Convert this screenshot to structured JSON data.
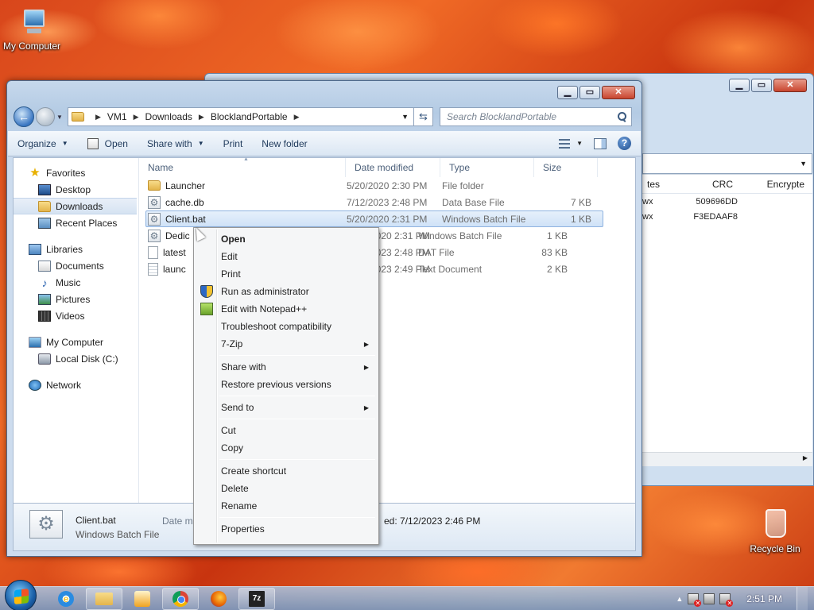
{
  "desktop": {
    "my_computer_label": "My Computer",
    "recycle_bin_label": "Recycle Bin"
  },
  "back_window": {
    "columns": [
      "tes",
      "CRC",
      "Encrypte"
    ],
    "rows": [
      {
        "a": "wx",
        "crc": "509696DD"
      },
      {
        "a": "wx",
        "crc": "F3EDAAF8"
      }
    ]
  },
  "explorer": {
    "breadcrumb": [
      "VM1",
      "Downloads",
      "BlocklandPortable"
    ],
    "search_placeholder": "Search BlocklandPortable",
    "toolbar": {
      "organize": "Organize",
      "open": "Open",
      "share_with": "Share with",
      "print": "Print",
      "new_folder": "New folder"
    },
    "sidebar": {
      "favorites": "Favorites",
      "desktop": "Desktop",
      "downloads": "Downloads",
      "recent_places": "Recent Places",
      "libraries": "Libraries",
      "documents": "Documents",
      "music": "Music",
      "pictures": "Pictures",
      "videos": "Videos",
      "my_computer": "My Computer",
      "local_disk": "Local Disk (C:)",
      "network": "Network"
    },
    "columns": {
      "name": "Name",
      "date": "Date modified",
      "type": "Type",
      "size": "Size"
    },
    "files": [
      {
        "name": "Launcher",
        "date": "5/20/2020 2:30 PM",
        "type": "File folder",
        "size": "",
        "icon": "folder-icon"
      },
      {
        "name": "cache.db",
        "date": "7/12/2023 2:48 PM",
        "type": "Data Base File",
        "size": "7 KB",
        "icon": "gear-file-icon"
      },
      {
        "name": "Client.bat",
        "date": "5/20/2020 2:31 PM",
        "type": "Windows Batch File",
        "size": "1 KB",
        "icon": "gear-file-icon"
      },
      {
        "name": "Dedic",
        "date": "2020 2:31 PM",
        "type": "Windows Batch File",
        "size": "1 KB",
        "icon": "gear-file-icon"
      },
      {
        "name": "latest",
        "date": "2023 2:48 PM",
        "type": "DAT File",
        "size": "83 KB",
        "icon": "blank-file-icon"
      },
      {
        "name": "launc",
        "date": "2023 2:49 PM",
        "type": "Text Document",
        "size": "2 KB",
        "icon": "text-file-icon"
      }
    ],
    "details": {
      "name": "Client.bat",
      "type": "Windows Batch File",
      "date_label": "Date mo",
      "date_value": "ed: 7/12/2023 2:46 PM"
    }
  },
  "context_menu": {
    "items": [
      "Open",
      "Edit",
      "Print",
      "Run as administrator",
      "Edit with Notepad++",
      "Troubleshoot compatibility",
      "7-Zip",
      "Share with",
      "Restore previous versions",
      "Send to",
      "Cut",
      "Copy",
      "Create shortcut",
      "Delete",
      "Rename",
      "Properties"
    ]
  },
  "taskbar": {
    "clock": "2:51 PM",
    "zip_label": "7z"
  }
}
